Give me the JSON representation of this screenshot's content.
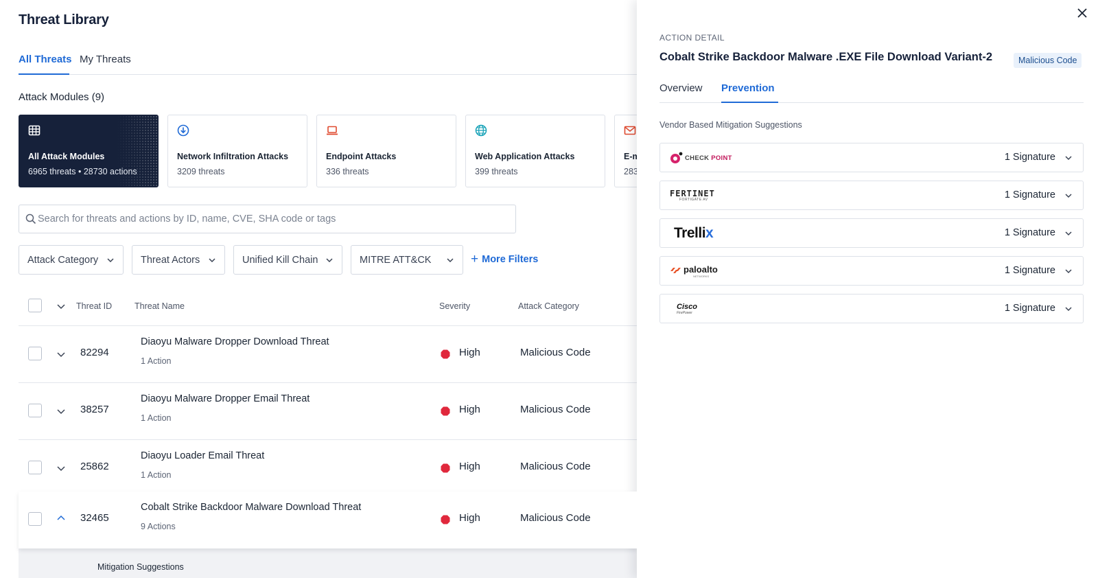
{
  "page": {
    "title": "Threat Library"
  },
  "tabs": [
    {
      "label": "All Threats"
    },
    {
      "label": "My Threats"
    }
  ],
  "modules": {
    "title": "Attack Modules (9)",
    "cards": [
      {
        "name": "All Attack Modules",
        "sub": "6965 threats • 28730 actions",
        "icon": "grid-icon"
      },
      {
        "name": "Network Infiltration Attacks",
        "sub": "3209 threats",
        "icon": "download-circle-icon"
      },
      {
        "name": "Endpoint Attacks",
        "sub": "336 threats",
        "icon": "laptop-icon"
      },
      {
        "name": "Web Application Attacks",
        "sub": "399 threats",
        "icon": "globe-icon"
      },
      {
        "name": "E-m",
        "sub": "283",
        "icon": "mail-icon"
      }
    ]
  },
  "search": {
    "placeholder": "Search for threats and actions by ID, name, CVE, SHA code or tags"
  },
  "filters": [
    {
      "label": "Attack Category"
    },
    {
      "label": "Threat Actors"
    },
    {
      "label": "Unified Kill Chain"
    },
    {
      "label": "MITRE ATT&CK"
    }
  ],
  "more_filters": "More Filters",
  "table": {
    "columns": {
      "id": "Threat ID",
      "name": "Threat Name",
      "severity": "Severity",
      "category": "Attack Category"
    },
    "rows": [
      {
        "id": "82294",
        "name": "Diaoyu Malware Dropper Download Threat",
        "actions": "1 Action",
        "severity": "High",
        "category": "Malicious Code"
      },
      {
        "id": "38257",
        "name": "Diaoyu Malware Dropper Email Threat",
        "actions": "1 Action",
        "severity": "High",
        "category": "Malicious Code"
      },
      {
        "id": "25862",
        "name": "Diaoyu Loader Email Threat",
        "actions": "1 Action",
        "severity": "High",
        "category": "Malicious Code"
      },
      {
        "id": "32465",
        "name": "Cobalt Strike Backdoor Malware Download Threat",
        "actions": "9 Actions",
        "severity": "High",
        "category": "Malicious Code"
      }
    ],
    "expanded_section": "Mitigation Suggestions"
  },
  "detail": {
    "eyebrow": "ACTION DETAIL",
    "title": "Cobalt Strike Backdoor Malware .EXE File Download Variant-2",
    "badge": "Malicious Code",
    "tabs": [
      {
        "label": "Overview"
      },
      {
        "label": "Prevention"
      }
    ],
    "section_label": "Vendor Based Mitigation Suggestions",
    "vendors": [
      {
        "logo_text": "CHECK POINT",
        "logo_a": "CHECK ",
        "logo_b": "POINT",
        "signatures": "1 Signature"
      },
      {
        "logo_text": "FERTINET",
        "logo_sub": "FORTIGATE AV",
        "signatures": "1 Signature"
      },
      {
        "logo_text": "Trellix",
        "logo_a": "Trelli",
        "logo_b": "x",
        "signatures": "1 Signature"
      },
      {
        "logo_text": "paloalto",
        "logo_sub": "NETWORKS",
        "signatures": "1 Signature"
      },
      {
        "logo_text": "Cisco",
        "logo_sub": "FirePower",
        "signatures": "1 Signature"
      }
    ]
  },
  "colors": {
    "accent": "#1f6ad6",
    "dark_card": "#16213a",
    "severity_high": "#e0283c",
    "badge_bg": "#e9f1fb"
  }
}
